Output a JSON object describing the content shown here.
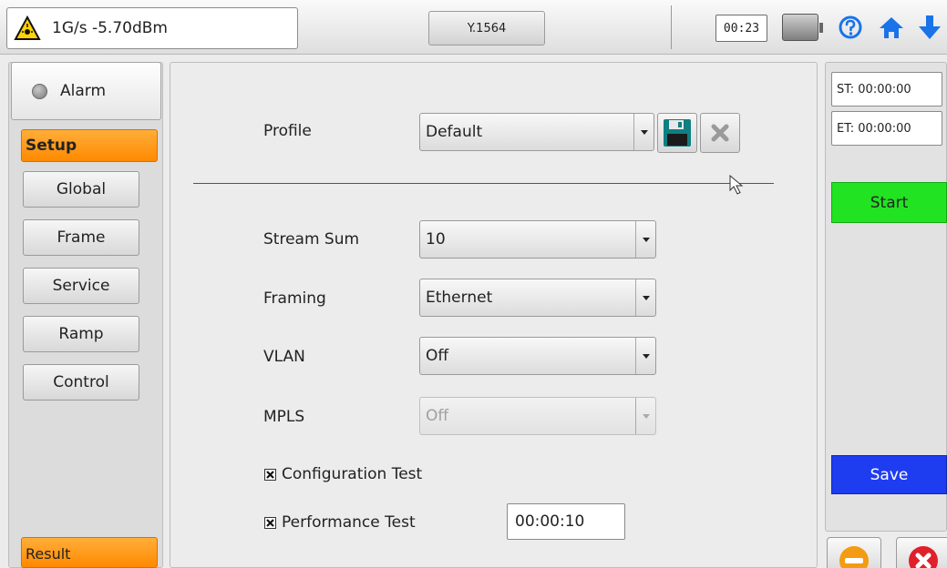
{
  "topbar": {
    "signal_text": "1G/s -5.70dBm",
    "mode_label": "Y.1564",
    "clock": "00:23",
    "icons": [
      "laser-warning-icon",
      "battery-icon",
      "help-icon",
      "home-icon",
      "download-arrow-icon"
    ]
  },
  "sidebar": {
    "alarm_label": "Alarm",
    "setup_label": "Setup",
    "items": [
      {
        "label": "Global"
      },
      {
        "label": "Frame"
      },
      {
        "label": "Service"
      },
      {
        "label": "Ramp"
      },
      {
        "label": "Control"
      }
    ],
    "result_label": "Result"
  },
  "form": {
    "profile": {
      "label": "Profile",
      "value": "Default"
    },
    "stream_sum": {
      "label": "Stream Sum",
      "value": "10"
    },
    "framing": {
      "label": "Framing",
      "value": "Ethernet"
    },
    "vlan": {
      "label": "VLAN",
      "value": "Off"
    },
    "mpls": {
      "label": "MPLS",
      "value": "Off",
      "disabled": true
    },
    "config_test": {
      "label": "Configuration Test",
      "checked": true
    },
    "perf_test": {
      "label": "Performance Test",
      "checked": true,
      "duration": "00:00:10"
    }
  },
  "rightpanel": {
    "st": "ST: 00:00:00",
    "et": "ET: 00:00:00",
    "start_label": "Start",
    "save_label": "Save"
  },
  "colors": {
    "orange_tab": "#ff8900",
    "start_green": "#22e322",
    "save_blue": "#1e3df0",
    "stop_red": "#e0202a",
    "minus_orange": "#f39c12",
    "icon_blue": "#1a73e8"
  }
}
